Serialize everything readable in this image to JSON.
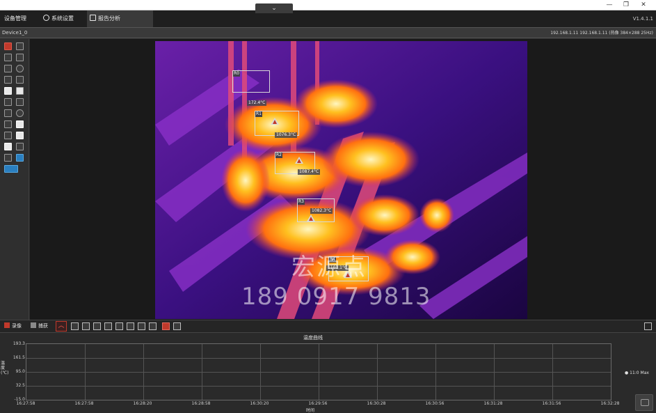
{
  "titlebar": {
    "collapse_glyph": "⌄",
    "min_glyph": "—",
    "restore_glyph": "❐",
    "close_glyph": "✕"
  },
  "menu": {
    "items": [
      {
        "label": "设备管理"
      },
      {
        "label": "系统设置",
        "icon": "gear-icon"
      },
      {
        "label": "报告分析",
        "icon": "edit-icon"
      }
    ],
    "version": "V1.4.1.1"
  },
  "info": {
    "device_name": "Device1_0",
    "ip_info": "192.168.1.11 192.168.1.11  (热像 384×288 25Hz)"
  },
  "rois": [
    {
      "label": "R0",
      "temp": "172.4°C"
    },
    {
      "label": "R1",
      "temp": "1076.3°C"
    },
    {
      "label": "R2",
      "temp": "1087.4°C"
    },
    {
      "label": "R3",
      "temp": "1082.3°C"
    },
    {
      "label": "R4",
      "temp": "1101.1°C"
    }
  ],
  "watermark": {
    "name": "宏源点",
    "phone": "189 0917 9813"
  },
  "bottombar": {
    "record_label": "录像",
    "tools_label": "捕获",
    "up_glyph": "︿"
  },
  "graph": {
    "title": "温度曲线",
    "y_axis_label": "温度(℃)",
    "x_axis_label": "时间",
    "legend": "● 11:0 Max",
    "y_ticks": [
      "193.3",
      "161.5",
      "95.0",
      "32.5",
      "-15.0"
    ],
    "x_ticks": [
      "16:27:58",
      "16:27:58",
      "16:28:20",
      "16:28:58",
      "16:30:20",
      "16:29:56",
      "16:30:28",
      "16:30:56",
      "16:31:28",
      "16:31:56",
      "16:32:28"
    ]
  }
}
